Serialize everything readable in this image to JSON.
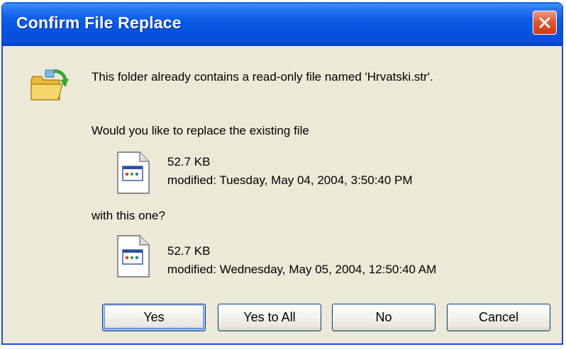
{
  "dialog": {
    "title": "Confirm File Replace",
    "message": "This folder already contains a read-only file named 'Hrvatski.str'.",
    "question": "Would you like to replace the existing file",
    "with_label": "with this one?",
    "existing_file": {
      "size": "52.7 KB",
      "modified": "modified: Tuesday, May 04, 2004, 3:50:40 PM"
    },
    "new_file": {
      "size": "52.7 KB",
      "modified": "modified: Wednesday, May 05, 2004, 12:50:40 AM"
    }
  },
  "buttons": {
    "yes": "Yes",
    "yes_to_all": "Yes to All",
    "no": "No",
    "cancel": "Cancel"
  },
  "icons": {
    "close": "close-icon",
    "folder": "folder-arrow-icon",
    "file": "file-document-icon"
  },
  "colors": {
    "titlebar": "#0552df",
    "dialog_background": "#ece9d8",
    "close_button": "#e2592f"
  }
}
